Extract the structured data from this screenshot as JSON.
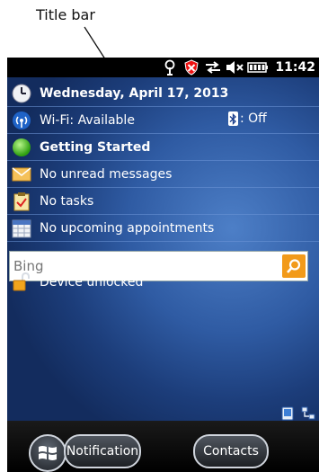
{
  "annotation": {
    "label": "Title bar"
  },
  "title_bar": {
    "time": "11:42",
    "icons": [
      "signal-antenna-icon",
      "no-sim-shield-icon",
      "data-sync-arrows-icon",
      "volume-muted-icon",
      "battery-icon"
    ]
  },
  "today": {
    "date": "Wednesday, April 17, 2013",
    "wifi": "Wi-Fi: Available",
    "bluetooth": ": Off",
    "getting_started": "Getting Started",
    "messages": "No unread messages",
    "tasks": "No tasks",
    "appointments": "No upcoming appointments"
  },
  "search": {
    "placeholder": "Bing"
  },
  "lock": {
    "status": "Device unlocked"
  },
  "softkeys": {
    "left": "Notification",
    "right": "Contacts"
  },
  "colors": {
    "accent_orange": "#f29a1a",
    "background_blue": "#2f5ba3",
    "title_bar": "#000000"
  }
}
